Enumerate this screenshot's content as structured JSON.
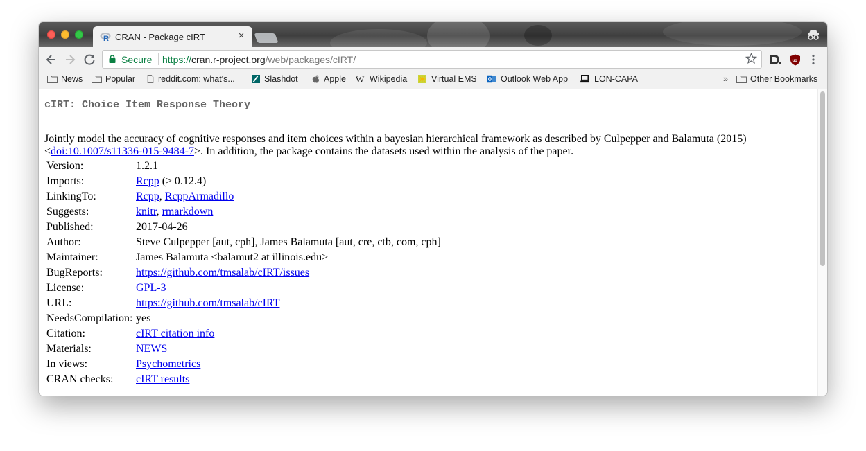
{
  "browser": {
    "tab": {
      "title": "CRAN - Package cIRT",
      "close_glyph": "×"
    },
    "omnibox": {
      "secure_label": "Secure",
      "url_scheme": "https://",
      "url_host": "cran.r-project.org",
      "url_path": "/web/packages/cIRT/"
    },
    "bookmarks": [
      {
        "label": "News",
        "icon": "folder-icon"
      },
      {
        "label": "Popular",
        "icon": "folder-icon"
      },
      {
        "label": "reddit.com: what's...",
        "icon": "page-icon"
      },
      {
        "label": "Slashdot",
        "icon": "slashdot-icon"
      },
      {
        "label": "Apple",
        "icon": "apple-icon"
      },
      {
        "label": "Wikipedia",
        "icon": "wikipedia-icon"
      },
      {
        "label": "Virtual EMS",
        "icon": "virtual-ems-icon"
      },
      {
        "label": "Outlook Web App",
        "icon": "outlook-icon"
      },
      {
        "label": "LON-CAPA",
        "icon": "loncapa-icon"
      }
    ],
    "bookmarks_overflow": "»",
    "other_bookmarks": "Other Bookmarks"
  },
  "page": {
    "title": "cIRT: Choice Item Response Theory",
    "description_before": "Jointly model the accuracy of cognitive responses and item choices within a bayesian hierarchical framework as described by Culpepper and Balamuta (2015) <",
    "description_link": "doi:10.1007/s11336-015-9484-7",
    "description_after": ">. In addition, the package contains the datasets used within the analysis of the paper.",
    "fields": {
      "version": {
        "label": "Version:",
        "value": "1.2.1"
      },
      "imports": {
        "label": "Imports:",
        "link": "Rcpp",
        "suffix": " (≥ 0.12.4)"
      },
      "linkingto": {
        "label": "LinkingTo:",
        "link1": "Rcpp",
        "sep": ", ",
        "link2": "RcppArmadillo"
      },
      "suggests": {
        "label": "Suggests:",
        "link1": "knitr",
        "sep": ", ",
        "link2": "rmarkdown"
      },
      "published": {
        "label": "Published:",
        "value": "2017-04-26"
      },
      "author": {
        "label": "Author:",
        "value": "Steve Culpepper [aut, cph], James Balamuta [aut, cre, ctb, com, cph]"
      },
      "maintainer": {
        "label": "Maintainer:",
        "value": "James Balamuta <balamut2 at illinois.edu>"
      },
      "bugreports": {
        "label": "BugReports:",
        "link": "https://github.com/tmsalab/cIRT/issues"
      },
      "license": {
        "label": "License:",
        "link": "GPL-3"
      },
      "url": {
        "label": "URL:",
        "link": "https://github.com/tmsalab/cIRT"
      },
      "needscompilation": {
        "label": "NeedsCompilation:",
        "value": "yes"
      },
      "citation": {
        "label": "Citation:",
        "link": "cIRT citation info"
      },
      "materials": {
        "label": "Materials:",
        "link": "NEWS"
      },
      "inviews": {
        "label": "In views:",
        "link": "Psychometrics"
      },
      "cranchecks": {
        "label": "CRAN checks:",
        "link": "cIRT results"
      }
    }
  }
}
